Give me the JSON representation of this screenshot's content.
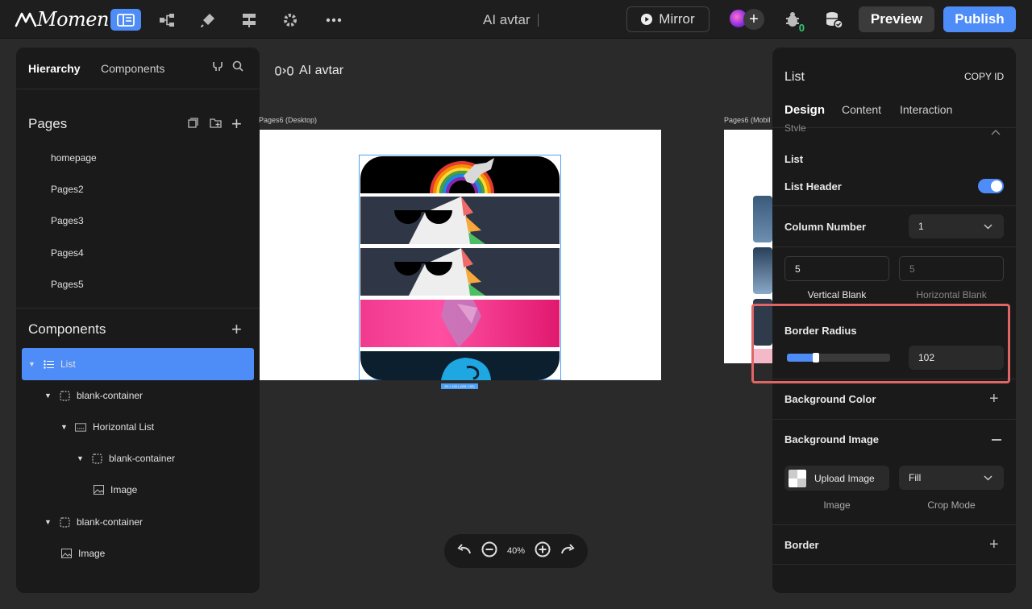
{
  "app": {
    "logo_text": "Momen",
    "project_title": "AI avtar"
  },
  "toolbar": {
    "mirror_label": "Mirror",
    "preview_label": "Preview",
    "publish_label": "Publish",
    "notification_count": "0",
    "accent_color": "#4e8cf7"
  },
  "left_panel": {
    "tabs": [
      "Hierarchy",
      "Components"
    ],
    "pages_title": "Pages",
    "pages": [
      "homepage",
      "Pages2",
      "Pages3",
      "Pages4",
      "Pages5"
    ],
    "components_title": "Components",
    "tree": [
      {
        "label": "List",
        "icon": "list-icon",
        "selected": true
      },
      {
        "label": "blank-container",
        "icon": "container-icon"
      },
      {
        "label": "Horizontal List",
        "icon": "horizontal-list-icon"
      },
      {
        "label": "blank-container",
        "icon": "container-icon"
      },
      {
        "label": "Image",
        "icon": "image-icon"
      },
      {
        "label": "blank-container",
        "icon": "container-icon"
      },
      {
        "label": "Image",
        "icon": "image-icon"
      }
    ]
  },
  "canvas": {
    "title": "AI avtar",
    "desktop_frame_label": "Pages6 (Desktop)",
    "mobile_frame_label": "Pages6 (Mobil",
    "size_tag": "90 × 100 | (426, 192)",
    "zoom_level": "40%"
  },
  "right_panel": {
    "component_name": "List",
    "copy_id_label": "COPY ID",
    "tabs": [
      "Design",
      "Content",
      "Interaction"
    ],
    "style_section_label": "Style",
    "list_label": "List",
    "list_header_label": "List Header",
    "list_header_enabled": true,
    "column_number_label": "Column Number",
    "column_number_value": "1",
    "vertical_blank_value": "5",
    "horizontal_blank_value": "5",
    "vertical_blank_label": "Vertical Blank",
    "horizontal_blank_label": "Horizontal Blank",
    "border_radius_label": "Border Radius",
    "border_radius_value": "102",
    "border_radius_slider_fraction": 0.28,
    "background_color_label": "Background Color",
    "background_image_label": "Background Image",
    "upload_image_label": "Upload Image",
    "crop_mode_value": "Fill",
    "image_caption": "Image",
    "crop_mode_caption": "Crop Mode",
    "border_label": "Border"
  }
}
